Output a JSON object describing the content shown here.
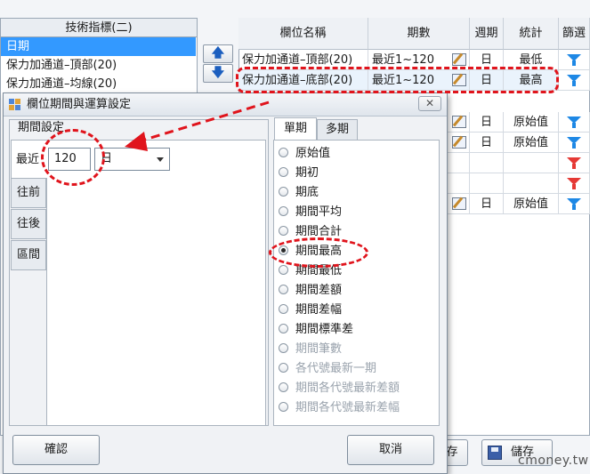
{
  "left_panel": {
    "header": "技術指標(二)",
    "items": [
      {
        "label": "日期",
        "selected": true
      },
      {
        "label": "保力加通道–頂部(20)",
        "selected": false
      },
      {
        "label": "保力加通道–均線(20)",
        "selected": false
      }
    ]
  },
  "move_buttons": {
    "up": "🡅",
    "down": "🡇"
  },
  "grid": {
    "columns": [
      "欄位名稱",
      "期數",
      "週期",
      "統計",
      "篩選"
    ],
    "rows": [
      {
        "name": "保力加通道–頂部(20)",
        "periods": "最近1~120",
        "cycle": "日",
        "stat": "最低",
        "filter": "blue"
      },
      {
        "name": "保力加通道–底部(20)",
        "periods": "最近1~120",
        "cycle": "日",
        "stat": "最高",
        "filter": "blue"
      },
      {
        "name": "",
        "periods": "",
        "cycle": "日",
        "stat": "原始值",
        "filter": "blue"
      },
      {
        "name": "",
        "periods": "",
        "cycle": "日",
        "stat": "原始值",
        "filter": "blue"
      },
      {
        "name": "",
        "periods": "",
        "cycle": "",
        "stat": "",
        "filter": "red"
      },
      {
        "name": "",
        "periods": "",
        "cycle": "",
        "stat": "",
        "filter": "red"
      },
      {
        "name": "",
        "periods": "",
        "cycle": "日",
        "stat": "原始值",
        "filter": "blue"
      }
    ]
  },
  "bottom_bar": {
    "partial_label": "存",
    "save_label": "儲存"
  },
  "dialog": {
    "title": "欄位期間與運算設定",
    "close": "✕",
    "period_group_label": "期間設定",
    "side_tabs": [
      "往前",
      "往後",
      "區間"
    ],
    "recent_label": "最近",
    "recent_value": "120",
    "unit_value": "日",
    "tabs": [
      "單期",
      "多期"
    ],
    "options": [
      {
        "label": "原始值",
        "checked": false,
        "enabled": true
      },
      {
        "label": "期初",
        "checked": false,
        "enabled": true
      },
      {
        "label": "期底",
        "checked": false,
        "enabled": true
      },
      {
        "label": "期間平均",
        "checked": false,
        "enabled": true
      },
      {
        "label": "期間合計",
        "checked": false,
        "enabled": true
      },
      {
        "label": "期間最高",
        "checked": true,
        "enabled": true
      },
      {
        "label": "期間最低",
        "checked": false,
        "enabled": true
      },
      {
        "label": "期間差額",
        "checked": false,
        "enabled": true
      },
      {
        "label": "期間差幅",
        "checked": false,
        "enabled": true
      },
      {
        "label": "期間標準差",
        "checked": false,
        "enabled": true
      },
      {
        "label": "期間筆數",
        "checked": false,
        "enabled": false
      },
      {
        "label": "各代號最新一期",
        "checked": false,
        "enabled": false
      },
      {
        "label": "期間各代號最新差額",
        "checked": false,
        "enabled": false
      },
      {
        "label": "期間各代號最新差幅",
        "checked": false,
        "enabled": false
      }
    ],
    "confirm_label": "確認",
    "cancel_label": "取消"
  },
  "watermark": "cmoney.tw",
  "colors": {
    "selection": "#3399ff",
    "annotation": "#e0141c",
    "filter_blue": "#1e88e5",
    "filter_red": "#e53935"
  }
}
